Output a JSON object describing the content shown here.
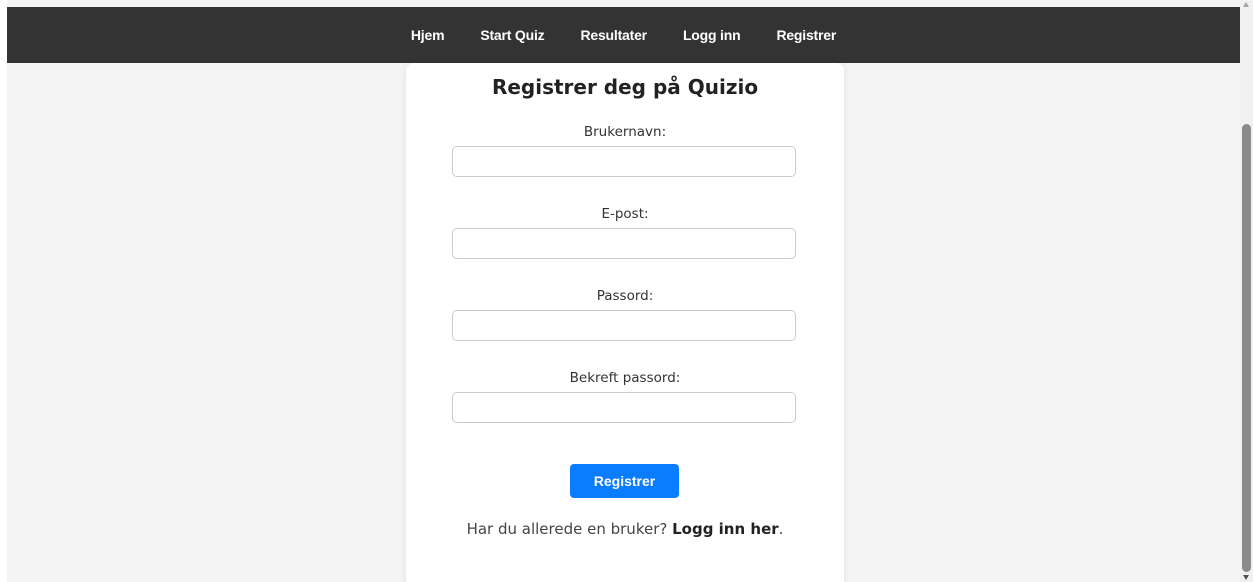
{
  "nav": {
    "items": [
      {
        "label": "Hjem"
      },
      {
        "label": "Start Quiz"
      },
      {
        "label": "Resultater"
      },
      {
        "label": "Logg inn"
      },
      {
        "label": "Registrer"
      }
    ]
  },
  "form": {
    "title": "Registrer deg på Quizio",
    "username": {
      "label": "Brukernavn:",
      "value": "",
      "placeholder": ""
    },
    "email": {
      "label": "E-post:",
      "value": "",
      "placeholder": ""
    },
    "password": {
      "label": "Passord:",
      "value": "",
      "placeholder": ""
    },
    "confirm_password": {
      "label": "Bekreft passord:",
      "value": "",
      "placeholder": ""
    },
    "submit_label": "Registrer",
    "login_prompt": "Har du allerede en bruker?",
    "login_link": "Logg inn her",
    "login_suffix": "."
  },
  "colors": {
    "navbar_bg": "#333333",
    "page_bg": "#f4f4f4",
    "accent": "#0a7cff"
  },
  "icons": {
    "scroll_up": "scroll-up-arrow-icon",
    "scroll_down": "scroll-down-arrow-icon"
  }
}
